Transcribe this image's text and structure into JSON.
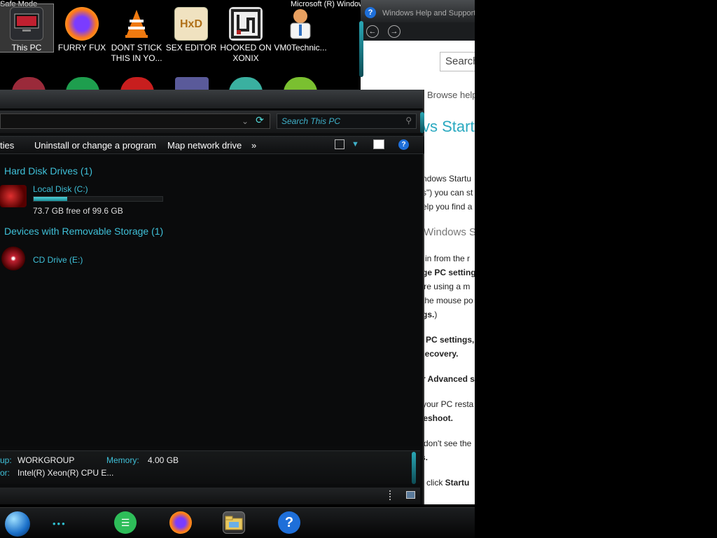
{
  "desktop": {
    "safe_mode_left": "Safe Mode",
    "safe_mode_right": "Microsoft (R) Window",
    "icons": [
      {
        "label": "This PC",
        "icon": "computer-icon",
        "color": "#c0c4c8",
        "selected": true
      },
      {
        "label": "FURRY FUX",
        "icon": "firefox-icon",
        "color": "#ff7a1a"
      },
      {
        "label": "DONT STICK THIS IN YO...",
        "icon": "vlc-cone-icon",
        "color": "#f07a10"
      },
      {
        "label": "SEX EDITOR",
        "icon": "hxd-editor-icon",
        "color": "#d8a040"
      },
      {
        "label": "HOOKED ON XONIX",
        "icon": "xonix-game-icon",
        "color": "#b02020"
      },
      {
        "label": "VM0Technic...",
        "icon": "doctor-avatar-icon",
        "color": "#e8a060"
      }
    ],
    "row2_icon_colors": [
      "#9a2a3a",
      "#1e9e4e",
      "#c81e1e",
      "#5a5a9a",
      "#3ab0a0",
      "#7ac030"
    ]
  },
  "explorer": {
    "search_placeholder": "Search This PC",
    "toolbar": {
      "properties": "ties",
      "uninstall": "Uninstall or change a program",
      "map_drive": "Map network drive",
      "more": "»"
    },
    "groups": {
      "hard_disk": "Hard Disk Drives (1)",
      "removable": "Devices with Removable Storage (1)"
    },
    "local_disk": {
      "label": "Local Disk (C:)",
      "free_text": "73.7 GB free of 99.6 GB",
      "used_fraction": 0.26
    },
    "cd_drive": {
      "label": "CD Drive (E:)"
    },
    "details": {
      "workgroup_label": "up:",
      "workgroup_value": "WORKGROUP",
      "memory_label": "Memory:",
      "memory_value": "4.00 GB",
      "processor_label": "or:",
      "processor_value": "Intel(R) Xeon(R) CPU E..."
    }
  },
  "help": {
    "title": "Windows Help and Support",
    "search_placeholder": "Search",
    "browse_text": "Browse help",
    "heading": "vs Startu",
    "lines": {
      "l1": "ndows Startu",
      "l2": "s\") you can st",
      "l3": "elp you find a",
      "subheading": "Windows S",
      "l4": "in from the r",
      "l5": "ge PC setting",
      "l6": "'re using a m",
      "l7": "the mouse po",
      "l8": "gs.",
      "l9": ")",
      "l10": "PC settings,",
      "l11": "Recovery.",
      "l12": "r Advanced s",
      "l13": "your PC resta",
      "l14": "leshoot.",
      "l15": "don't see the",
      "l16": "s.",
      "l17_pre": "click ",
      "l17_bold": "Startu"
    }
  },
  "taskbar": {
    "dots": "•••",
    "apps": [
      {
        "icon": "notes-app-icon",
        "color": "#2ebd59"
      },
      {
        "icon": "firefox-icon",
        "color": "#ff7a1a"
      },
      {
        "icon": "file-explorer-icon",
        "color": "#e8c860",
        "active": true
      },
      {
        "icon": "help-icon",
        "color": "#1e6fd9"
      }
    ]
  }
}
